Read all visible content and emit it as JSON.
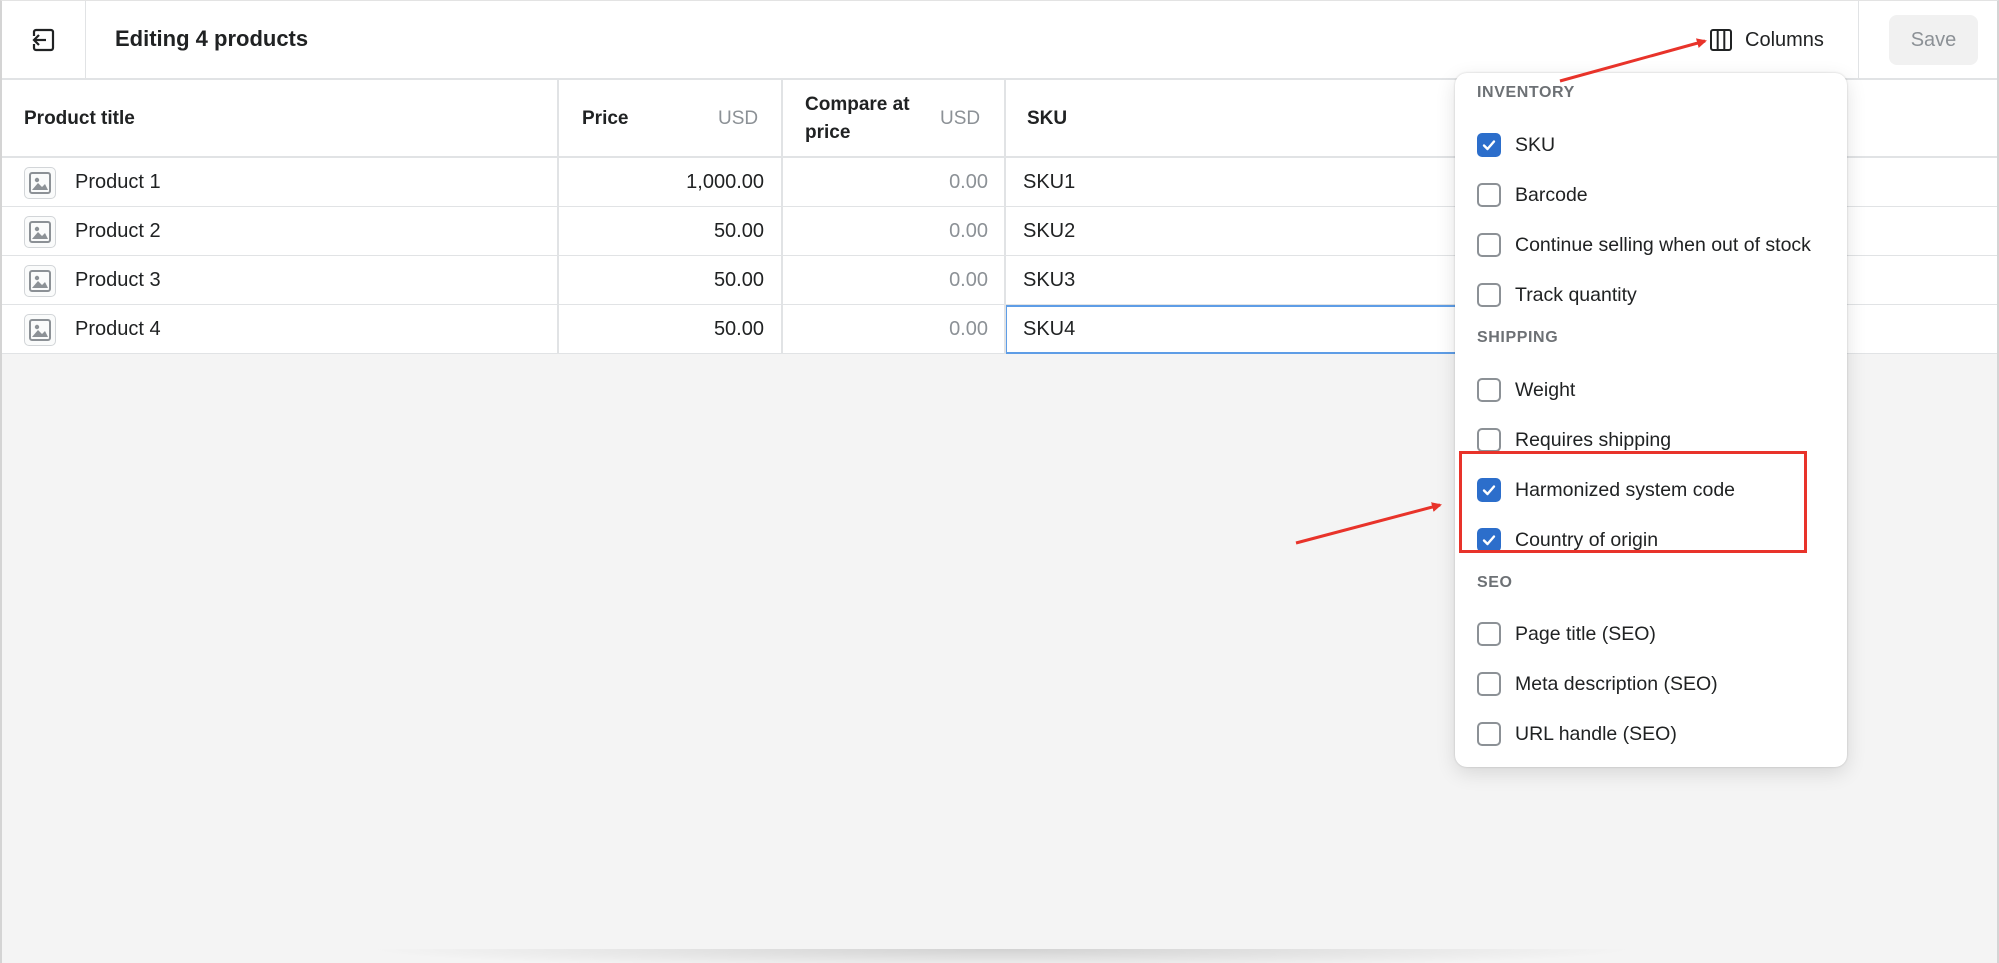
{
  "header": {
    "title": "Editing 4 products",
    "exit_icon": "exit-icon",
    "columns_label": "Columns",
    "columns_icon": "columns-icon",
    "save_label": "Save"
  },
  "table": {
    "columns": {
      "title": "Product title",
      "price": "Price",
      "price_unit": "USD",
      "compare_line1": "Compare at",
      "compare_line2": "price",
      "compare_unit": "USD",
      "sku": "SKU"
    },
    "rows": [
      {
        "title": "Product 1",
        "price": "1,000.00",
        "compare": "0.00",
        "sku": "SKU1"
      },
      {
        "title": "Product 2",
        "price": "50.00",
        "compare": "0.00",
        "sku": "SKU2"
      },
      {
        "title": "Product 3",
        "price": "50.00",
        "compare": "0.00",
        "sku": "SKU3"
      },
      {
        "title": "Product 4",
        "price": "50.00",
        "compare": "0.00",
        "sku": "SKU4"
      }
    ]
  },
  "columns_menu": {
    "sections": [
      {
        "label": "INVENTORY",
        "options": [
          {
            "label": "SKU",
            "checked": true
          },
          {
            "label": "Barcode",
            "checked": false
          },
          {
            "label": "Continue selling when out of stock",
            "checked": false
          },
          {
            "label": "Track quantity",
            "checked": false
          }
        ]
      },
      {
        "label": "SHIPPING",
        "options": [
          {
            "label": "Weight",
            "checked": false
          },
          {
            "label": "Requires shipping",
            "checked": false
          },
          {
            "label": "Harmonized system code",
            "checked": true
          },
          {
            "label": "Country of origin",
            "checked": true
          }
        ]
      },
      {
        "label": "SEO",
        "options": [
          {
            "label": "Page title (SEO)",
            "checked": false
          },
          {
            "label": "Meta description (SEO)",
            "checked": false
          },
          {
            "label": "URL handle (SEO)",
            "checked": false
          }
        ]
      }
    ]
  },
  "colors": {
    "checkbox_checked": "#2c6ecb",
    "annotation": "#e8332a",
    "selected_cell_border": "#5e9de6"
  }
}
